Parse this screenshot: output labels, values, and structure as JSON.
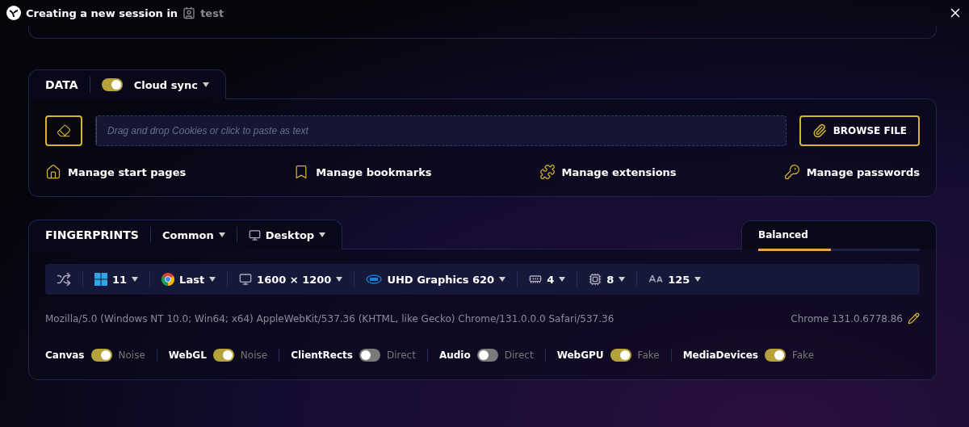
{
  "header": {
    "title": "Creating a new session in",
    "folder": "test"
  },
  "data": {
    "title": "DATA",
    "cloud_sync": {
      "label": "Cloud sync",
      "on": true
    },
    "cookies": {
      "placeholder": "Drag and drop Cookies or click to paste as text"
    },
    "browse_button": "BROWSE FILE",
    "links": [
      {
        "kind": "home",
        "label": "Manage start pages"
      },
      {
        "kind": "bookmark",
        "label": "Manage bookmarks"
      },
      {
        "kind": "puzzle",
        "label": "Manage extensions"
      },
      {
        "kind": "key",
        "label": "Manage passwords"
      }
    ]
  },
  "fingerprints": {
    "title": "FINGERPRINTS",
    "preset": "Common",
    "device": "Desktop",
    "profile": {
      "label": "Balanced",
      "level": 0.45
    },
    "params": [
      {
        "kind": "windows",
        "value": "11"
      },
      {
        "kind": "chrome",
        "value": "Last"
      },
      {
        "kind": "screen",
        "value": "1600 × 1200"
      },
      {
        "kind": "gpu",
        "value": "UHD Graphics 620"
      },
      {
        "kind": "memory",
        "value": "4"
      },
      {
        "kind": "cpu",
        "value": "8"
      },
      {
        "kind": "font",
        "value": "125"
      }
    ],
    "user_agent": "Mozilla/5.0 (Windows NT 10.0; Win64; x64) AppleWebKit/537.36 (KHTML, like Gecko) Chrome/131.0.0.0 Safari/537.36",
    "browser_version": "Chrome 131.0.6778.86",
    "toggles": [
      {
        "label": "Canvas",
        "on": true,
        "mode": "Noise"
      },
      {
        "label": "WebGL",
        "on": true,
        "mode": "Noise"
      },
      {
        "label": "ClientRects",
        "on": false,
        "mode": "Direct"
      },
      {
        "label": "Audio",
        "on": false,
        "mode": "Direct"
      },
      {
        "label": "WebGPU",
        "on": true,
        "mode": "Fake"
      },
      {
        "label": "MediaDevices",
        "on": true,
        "mode": "Fake"
      }
    ]
  }
}
